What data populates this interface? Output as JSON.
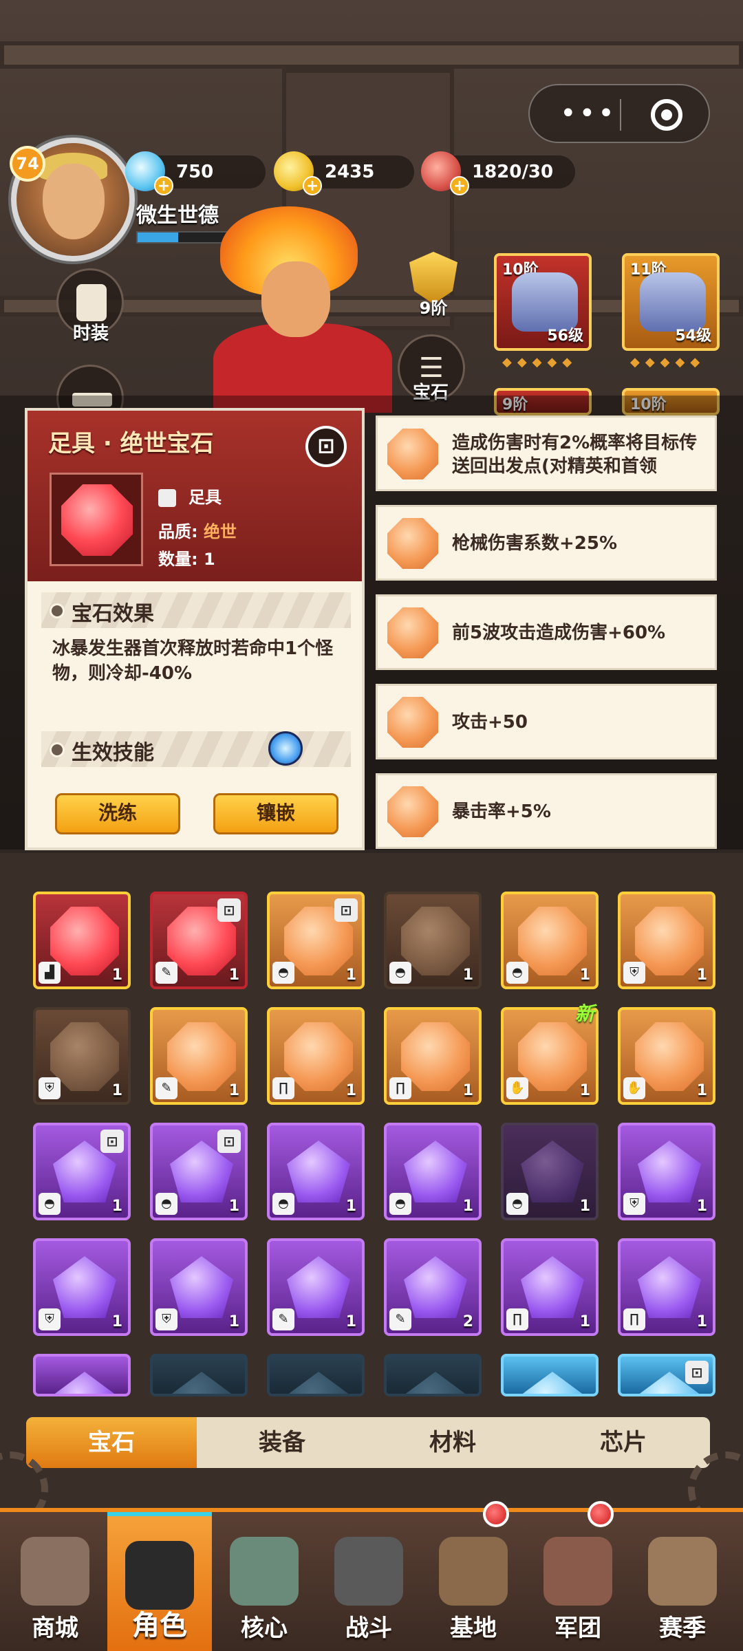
{
  "header": {
    "level": "74",
    "player_name": "微生世德",
    "xp_fraction": 0.22,
    "resources": [
      {
        "icon": "diamond-icon",
        "value": "750"
      },
      {
        "icon": "gold-coin-icon",
        "value": "2435"
      },
      {
        "icon": "meat-stamina-icon",
        "value": "1820/30"
      }
    ],
    "capsule": {
      "menu_icon": "more-dots-icon",
      "close_icon": "target-close-icon"
    }
  },
  "side_buttons": {
    "costume": "时装",
    "gem": "宝石"
  },
  "hero": {
    "rank": "9阶"
  },
  "equipment": [
    {
      "tier": "10阶",
      "level": "56级"
    },
    {
      "tier": "11阶",
      "level": "54级"
    },
    {
      "tier": "9阶"
    },
    {
      "tier": "10阶"
    }
  ],
  "gem_popup": {
    "title": "足具 · 绝世宝石",
    "lock_icon": "lock-icon",
    "slot_label": "足具",
    "quality_label": "品质:",
    "quality_value": "绝世",
    "count_label": "数量:",
    "count_value": "1",
    "effect_heading": "宝石效果",
    "effect_text": "冰暴发生器首次释放时若命中1个怪物，则冷却-40%",
    "skill_heading": "生效技能",
    "wash_button": "洗练",
    "inlay_button": "镶嵌"
  },
  "stats": [
    "造成伤害时有2%概率将目标传送回出发点(对精英和首领",
    "枪械伤害系数+25%",
    "前5波攻击造成伤害+60%",
    "攻击+50",
    "暴击率+5%"
  ],
  "inventory": {
    "new_tag": "新",
    "rows": [
      [
        {
          "kind": "red",
          "part": "boot",
          "count": "1",
          "lock": false
        },
        {
          "kind": "red2",
          "part": "glove",
          "count": "1",
          "lock": true
        },
        {
          "kind": "orange",
          "part": "helmet",
          "count": "1",
          "lock": true
        },
        {
          "kind": "orangeDim",
          "part": "helmet",
          "count": "1",
          "lock": false
        },
        {
          "kind": "orange",
          "part": "helmet",
          "count": "1",
          "lock": false
        },
        {
          "kind": "orange",
          "part": "armor",
          "count": "1",
          "lock": false
        }
      ],
      [
        {
          "kind": "orangeDim",
          "part": "armor",
          "count": "1",
          "lock": false
        },
        {
          "kind": "orange",
          "part": "glove",
          "count": "1",
          "lock": false
        },
        {
          "kind": "orange",
          "part": "pants",
          "count": "1",
          "lock": false
        },
        {
          "kind": "orange",
          "part": "pants",
          "count": "1",
          "lock": false
        },
        {
          "kind": "orange",
          "part": "hand",
          "count": "1",
          "lock": false
        },
        {
          "kind": "orange",
          "part": "hand",
          "count": "1",
          "lock": false
        }
      ],
      [
        {
          "kind": "purple",
          "part": "helmet",
          "count": "1",
          "lock": true
        },
        {
          "kind": "purple",
          "part": "helmet",
          "count": "1",
          "lock": true
        },
        {
          "kind": "purple",
          "part": "helmet",
          "count": "1",
          "lock": false
        },
        {
          "kind": "purple",
          "part": "helmet",
          "count": "1",
          "lock": false
        },
        {
          "kind": "purpleDim",
          "part": "helmet",
          "count": "1",
          "lock": false
        },
        {
          "kind": "purple",
          "part": "armor",
          "count": "1",
          "lock": false
        }
      ],
      [
        {
          "kind": "purple",
          "part": "armor",
          "count": "1",
          "lock": false
        },
        {
          "kind": "purple",
          "part": "armor",
          "count": "1",
          "lock": false
        },
        {
          "kind": "purple",
          "part": "glove",
          "count": "1",
          "lock": false
        },
        {
          "kind": "purple",
          "part": "glove",
          "count": "2",
          "lock": false
        },
        {
          "kind": "purple",
          "part": "pants",
          "count": "1",
          "lock": false
        },
        {
          "kind": "purple",
          "part": "pants",
          "count": "1",
          "lock": false
        }
      ],
      [
        {
          "kind": "purple",
          "part": "",
          "count": "",
          "lock": false
        },
        {
          "kind": "blueDim",
          "part": "",
          "count": "",
          "lock": false
        },
        {
          "kind": "blueDim",
          "part": "",
          "count": "",
          "lock": false
        },
        {
          "kind": "blueDim",
          "part": "",
          "count": "",
          "lock": false
        },
        {
          "kind": "blue",
          "part": "",
          "count": "",
          "lock": false
        },
        {
          "kind": "blue",
          "part": "",
          "count": "",
          "lock": true
        }
      ]
    ]
  },
  "tabs": [
    "宝石",
    "装备",
    "材料",
    "芯片"
  ],
  "active_tab": 0,
  "nav": [
    {
      "label": "商城",
      "icon": "shop-icon",
      "badge": false
    },
    {
      "label": "角色",
      "icon": "character-icon",
      "badge": false
    },
    {
      "label": "核心",
      "icon": "core-icon",
      "badge": false
    },
    {
      "label": "战斗",
      "icon": "battle-guns-icon",
      "badge": false
    },
    {
      "label": "基地",
      "icon": "base-tower-icon",
      "badge": true
    },
    {
      "label": "军团",
      "icon": "legion-emblem-icon",
      "badge": true
    },
    {
      "label": "赛季",
      "icon": "season-compass-icon",
      "badge": false
    }
  ],
  "active_nav": 1,
  "colors": {
    "accent": "#f08a1a",
    "popup_red": "#a8322a",
    "tab_active": "#e07a12"
  }
}
